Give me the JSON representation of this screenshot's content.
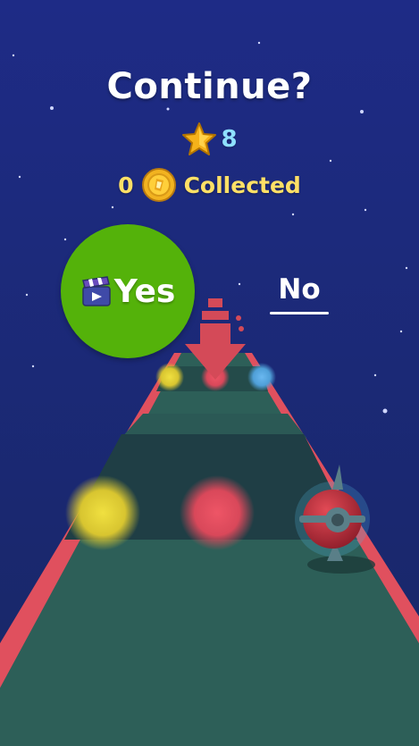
{
  "dialog": {
    "title": "Continue?",
    "stars": "8",
    "coins_collected": "0",
    "collected_label": "Collected",
    "yes_label": "Yes",
    "no_label": "No"
  },
  "icons": {
    "star": "star-icon",
    "coin": "coin-icon",
    "video": "clapperboard-icon",
    "arrow": "down-arrow-icon",
    "player": "player-ball-icon"
  },
  "colors": {
    "sky": "#1a2a7a",
    "track": "#2d5f58",
    "track_edge": "#e0505e",
    "yes_button": "#54b20a",
    "orb_yellow": "#e6d23a",
    "orb_red": "#e04b5c",
    "orb_blue": "#5aa8e0",
    "stars_count": "#8fe0ff",
    "coin_text": "#ffe066"
  }
}
